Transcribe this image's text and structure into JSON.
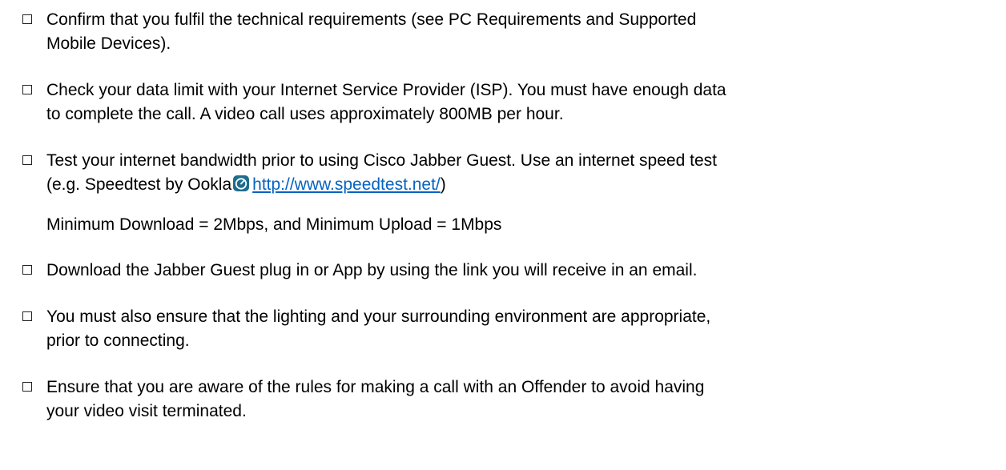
{
  "checklist": {
    "items": [
      {
        "lines": [
          "Confirm that you fulfil the technical requirements (see PC Requirements and Supported",
          "Mobile Devices)."
        ]
      },
      {
        "lines": [
          "Check your data limit with your Internet Service Provider (ISP). You must have enough data",
          "to complete the call. A video call uses approximately 800MB per hour."
        ]
      },
      {
        "line1": "Test your internet bandwidth prior to using Cisco Jabber Guest. Use an internet speed test",
        "line2_prefix": "(e.g. Speedtest by Ookla",
        "link_text": "http://www.speedtest.net/",
        "line2_suffix": ")",
        "icon": "speedtest-gauge-icon",
        "icon_color": "#1c6e8c",
        "note": "Minimum Download = 2Mbps, and Minimum Upload = 1Mbps"
      },
      {
        "lines": [
          "Download the Jabber Guest plug in or App by using the link you will receive in an email."
        ]
      },
      {
        "lines": [
          "You must also ensure that the lighting and your surrounding environment are appropriate,",
          "prior to connecting."
        ]
      },
      {
        "lines": [
          "Ensure that you are aware of the rules for making a call with an Offender to avoid having",
          "your video visit terminated."
        ]
      }
    ]
  },
  "colors": {
    "text": "#000000",
    "link": "#0563c1",
    "checkbox_border": "#222222"
  }
}
